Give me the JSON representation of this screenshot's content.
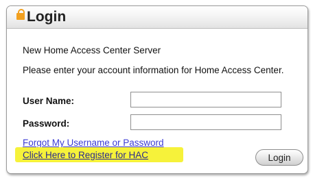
{
  "panel": {
    "title": "Login",
    "lock_icon": "lock-icon",
    "server_text": "New Home Access Center Server",
    "instructions": "Please enter your account information for Home Access Center.",
    "username_label": "User Name:",
    "username_value": "",
    "password_label": "Password:",
    "password_value": "",
    "forgot_link": "Forgot My Username or Password",
    "register_link": "Click Here to Register for HAC",
    "login_button": "Login"
  },
  "colors": {
    "lock": "#f2a01f",
    "highlight": "#f6f23a",
    "link": "#3b3bd4"
  }
}
